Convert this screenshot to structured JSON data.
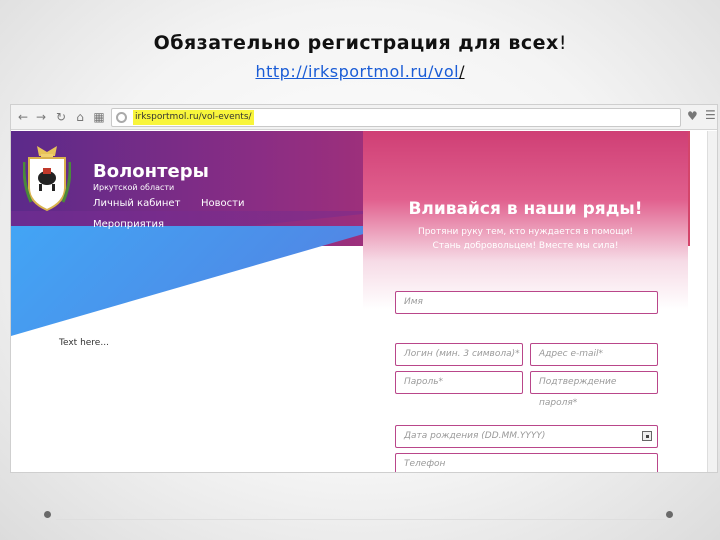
{
  "slide": {
    "title": "Обязательно регистрация для всех",
    "title_punct": "!",
    "link": "http://irksportmol.ru/vol",
    "link_slash": "/"
  },
  "browser": {
    "url": "irksportmol.ru/vol-events/",
    "back_icon": "arrow-left-icon",
    "forward_icon": "arrow-right-icon",
    "reload_icon": "reload-icon",
    "home_icon": "home-icon",
    "apps_icon": "grid-icon",
    "favorite_icon": "heart-icon",
    "menu_icon": "menu-icon"
  },
  "site": {
    "brand": "Волонтеры",
    "brand_sub": "Иркутской области",
    "nav": {
      "cabinet": "Личный кабинет",
      "news": "Новости",
      "events": "Мероприятия"
    },
    "body_text": "Text here..."
  },
  "form": {
    "title": "Вливайся в наши ряды!",
    "sub1": "Протяни руку тем, кто нуждается в помощи!",
    "sub2": "Стань добровольцем! Вместе мы сила!",
    "fields": {
      "name": "Имя",
      "login": "Логин (мин. 3 символа)*",
      "email": "Адрес e-mail*",
      "password": "Пароль*",
      "password_confirm": "Подтверждение пароля*",
      "birthdate": "Дата рождения (DD.MM.YYYY)",
      "phone": "Телефон"
    }
  },
  "colors": {
    "accent_purple": "#6a2c90",
    "accent_pink": "#d9486a",
    "link_blue": "#1a5cd6",
    "url_highlight": "#f8f53b"
  }
}
